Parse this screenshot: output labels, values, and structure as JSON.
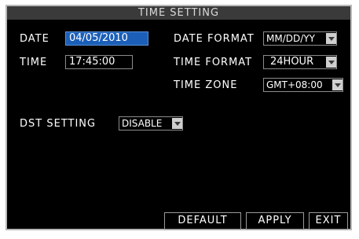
{
  "caption": "",
  "window": {
    "title": "TIME SETTING"
  },
  "date": {
    "label": "DATE",
    "value": "04/05/2010"
  },
  "time": {
    "label": "TIME",
    "value": "17:45:00"
  },
  "date_format": {
    "label": "DATE FORMAT",
    "value": "MM/DD/YY"
  },
  "time_format": {
    "label": "TIME FORMAT",
    "value": "24HOUR"
  },
  "time_zone": {
    "label": "TIME ZONE",
    "value": "GMT+08:00"
  },
  "dst": {
    "label": "DST SETTING",
    "value": "DISABLE"
  },
  "buttons": {
    "default": "DEFAULT",
    "apply": "APPLY",
    "exit": "EXIT"
  },
  "colors": {
    "selected_field": "#1b5fb8",
    "background": "#000000",
    "title_bar": "#3a3a3a"
  }
}
